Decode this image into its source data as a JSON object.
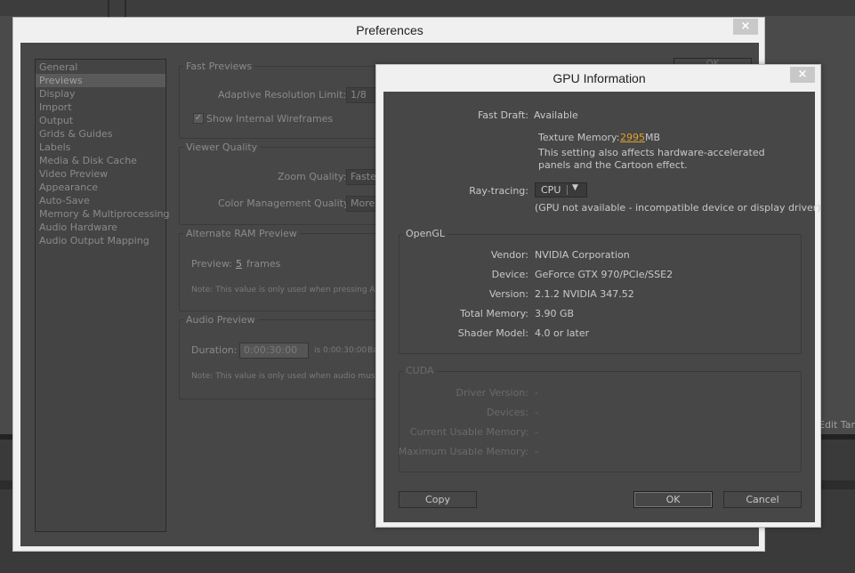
{
  "background": {
    "edit_tab_label": "Edit Tar"
  },
  "preferences": {
    "title": "Preferences",
    "close": "×",
    "ok_button": "OK",
    "nav_items": [
      "General",
      "Previews",
      "Display",
      "Import",
      "Output",
      "Grids & Guides",
      "Labels",
      "Media & Disk Cache",
      "Video Preview",
      "Appearance",
      "Auto-Save",
      "Memory & Multiprocessing",
      "Audio Hardware",
      "Audio Output Mapping"
    ],
    "selected_nav": "Previews",
    "fast_previews": {
      "title": "Fast Previews",
      "adaptive_label": "Adaptive Resolution Limit:",
      "adaptive_value": "1/8",
      "show_wireframes_label": "Show Internal Wireframes",
      "show_wireframes_checked": true
    },
    "viewer_quality": {
      "title": "Viewer Quality",
      "zoom_label": "Zoom Quality:",
      "zoom_value": "Faste",
      "color_label": "Color Management Quality:",
      "color_value": "More"
    },
    "alt_ram": {
      "title": "Alternate RAM Preview",
      "preview_label": "Preview:",
      "preview_value": "5",
      "frames_label": "frames",
      "note": "Note: This value is only used when pressing Al"
    },
    "audio_preview": {
      "title": "Audio Preview",
      "duration_label": "Duration:",
      "duration_value": "0:00:30:00",
      "duration_equiv": "is 0:00:30:00",
      "duration_base": "Ba",
      "note": "Note: This value is only used when audio must"
    }
  },
  "gpu": {
    "title": "GPU Information",
    "close": "×",
    "fast_draft_label": "Fast Draft:",
    "fast_draft_value": "Available",
    "texture_memory_label": "Texture Memory:",
    "texture_memory_value": "2995",
    "texture_memory_unit": "MB",
    "note_line1": "This setting also affects hardware-accelerated",
    "note_line2": "panels and the Cartoon effect.",
    "ray_tracing_label": "Ray-tracing:",
    "ray_tracing_value": "CPU",
    "ray_tracing_arrow": "▼",
    "ray_tracing_note": "(GPU not available - incompatible device or display driver)",
    "opengl": {
      "title": "OpenGL",
      "rows": [
        {
          "label": "Vendor:",
          "value": "NVIDIA Corporation"
        },
        {
          "label": "Device:",
          "value": "GeForce GTX 970/PCIe/SSE2"
        },
        {
          "label": "Version:",
          "value": "2.1.2 NVIDIA 347.52"
        },
        {
          "label": "Total Memory:",
          "value": "3.90 GB"
        },
        {
          "label": "Shader Model:",
          "value": "4.0 or later"
        }
      ]
    },
    "cuda": {
      "title": "CUDA",
      "rows": [
        {
          "label": "Driver Version:",
          "value": "-"
        },
        {
          "label": "Devices:",
          "value": "-"
        },
        {
          "label": "Current Usable Memory:",
          "value": "-"
        },
        {
          "label": "Maximum Usable Memory:",
          "value": "-"
        }
      ]
    },
    "buttons": {
      "copy": "Copy",
      "ok": "OK",
      "cancel": "Cancel"
    }
  },
  "colors": {
    "panel_bg": "#474747",
    "chrome_bg": "#f0f0f0",
    "accent_value": "#e0a12e"
  }
}
